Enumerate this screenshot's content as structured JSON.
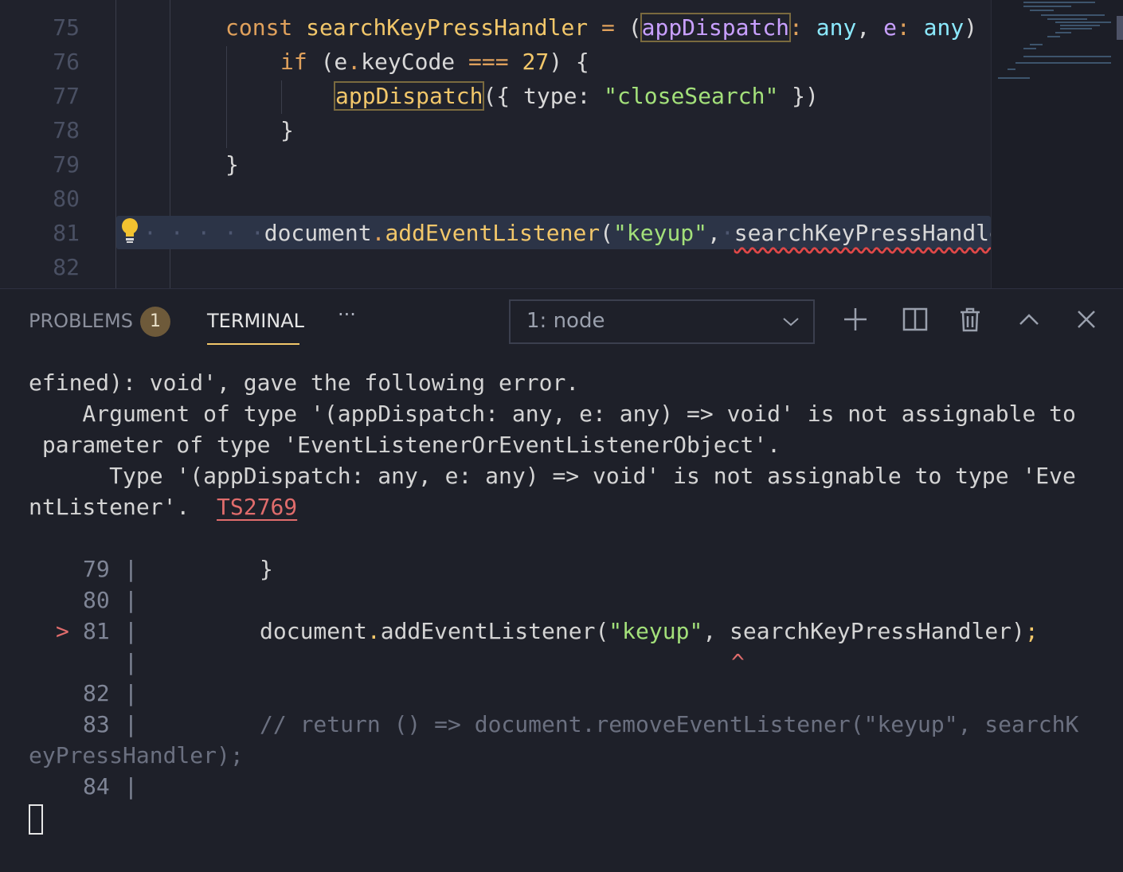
{
  "editor": {
    "line_numbers": [
      "75",
      "76",
      "77",
      "78",
      "79",
      "80",
      "81",
      "82"
    ],
    "line75": {
      "kw": "const",
      "name": "searchKeyPressHandler",
      "eq": "=",
      "paren": "(",
      "p1": "appDispatch",
      "colon1": ":",
      "t1": "any",
      "comma": ",",
      "p2": "e",
      "colon2": ":",
      "t2": "any",
      "close": ")"
    },
    "line76": {
      "kw": "if",
      "pre": "(e",
      "dot": ".",
      "prop": "keyCode",
      "op": "===",
      "num": "27",
      "post": ") {"
    },
    "line77": {
      "fn": "appDispatch",
      "pre": "({ type:",
      "str": "\"closeSearch\"",
      "post": " })"
    },
    "line78": {
      "text": "}"
    },
    "line79": {
      "text": "}"
    },
    "line81": {
      "dots": "· · · · ·",
      "obj": "document",
      "dot": ".",
      "method": "addEventListener",
      "open": "(",
      "str": "\"keyup\"",
      "comma": ",",
      "dot2": "·",
      "arg": "searchKeyPressHandler"
    },
    "colors": {
      "keyword": "#e0a15c",
      "function": "#f2c76a",
      "type": "#8be9fd",
      "string": "#a3e07a",
      "error": "#e04848"
    }
  },
  "panel": {
    "tabs": [
      {
        "label": "PROBLEMS",
        "badge": "1"
      },
      {
        "label": "TERMINAL"
      }
    ],
    "more": "···",
    "terminal_select": "1: node"
  },
  "terminal": {
    "lines": [
      "efined): void', gave the following error.",
      "    Argument of type '(appDispatch: any, e: any) => void' is not assignable to",
      " parameter of type 'EventListenerOrEventListenerObject'.",
      "      Type '(appDispatch: any, e: any) => void' is not assignable to type 'Eve",
      "ntListener'.  "
    ],
    "error_code": "TS2769",
    "snippet": {
      "l79_num": "79",
      "l79_code": "}",
      "l80_num": "80",
      "l81_marker": ">",
      "l81_num": "81",
      "l81_obj": "document",
      "l81_dot": ".",
      "l81_method": "addEventListener(",
      "l81_str": "\"keyup\"",
      "l81_rest": ", searchKeyPressHandler)",
      "l81_semi": ";",
      "caret": "^",
      "l82_num": "82",
      "l83_num": "83",
      "l83_comment": "// return () => document.removeEventListener(\"keyup\", searchK",
      "l83_wrap": "eyPressHandler);",
      "l84_num": "84",
      "pipe": "|"
    }
  }
}
